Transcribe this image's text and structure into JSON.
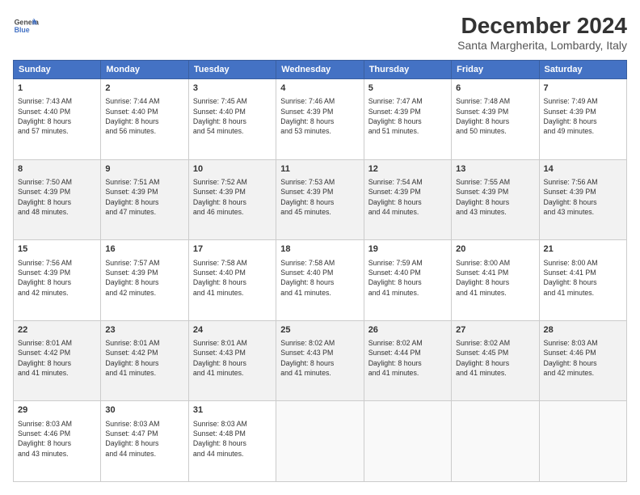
{
  "header": {
    "logo_general": "General",
    "logo_blue": "Blue",
    "title": "December 2024",
    "subtitle": "Santa Margherita, Lombardy, Italy"
  },
  "days_of_week": [
    "Sunday",
    "Monday",
    "Tuesday",
    "Wednesday",
    "Thursday",
    "Friday",
    "Saturday"
  ],
  "weeks": [
    [
      {
        "day": "1",
        "info": "Sunrise: 7:43 AM\nSunset: 4:40 PM\nDaylight: 8 hours\nand 57 minutes."
      },
      {
        "day": "2",
        "info": "Sunrise: 7:44 AM\nSunset: 4:40 PM\nDaylight: 8 hours\nand 56 minutes."
      },
      {
        "day": "3",
        "info": "Sunrise: 7:45 AM\nSunset: 4:40 PM\nDaylight: 8 hours\nand 54 minutes."
      },
      {
        "day": "4",
        "info": "Sunrise: 7:46 AM\nSunset: 4:39 PM\nDaylight: 8 hours\nand 53 minutes."
      },
      {
        "day": "5",
        "info": "Sunrise: 7:47 AM\nSunset: 4:39 PM\nDaylight: 8 hours\nand 51 minutes."
      },
      {
        "day": "6",
        "info": "Sunrise: 7:48 AM\nSunset: 4:39 PM\nDaylight: 8 hours\nand 50 minutes."
      },
      {
        "day": "7",
        "info": "Sunrise: 7:49 AM\nSunset: 4:39 PM\nDaylight: 8 hours\nand 49 minutes."
      }
    ],
    [
      {
        "day": "8",
        "info": "Sunrise: 7:50 AM\nSunset: 4:39 PM\nDaylight: 8 hours\nand 48 minutes."
      },
      {
        "day": "9",
        "info": "Sunrise: 7:51 AM\nSunset: 4:39 PM\nDaylight: 8 hours\nand 47 minutes."
      },
      {
        "day": "10",
        "info": "Sunrise: 7:52 AM\nSunset: 4:39 PM\nDaylight: 8 hours\nand 46 minutes."
      },
      {
        "day": "11",
        "info": "Sunrise: 7:53 AM\nSunset: 4:39 PM\nDaylight: 8 hours\nand 45 minutes."
      },
      {
        "day": "12",
        "info": "Sunrise: 7:54 AM\nSunset: 4:39 PM\nDaylight: 8 hours\nand 44 minutes."
      },
      {
        "day": "13",
        "info": "Sunrise: 7:55 AM\nSunset: 4:39 PM\nDaylight: 8 hours\nand 43 minutes."
      },
      {
        "day": "14",
        "info": "Sunrise: 7:56 AM\nSunset: 4:39 PM\nDaylight: 8 hours\nand 43 minutes."
      }
    ],
    [
      {
        "day": "15",
        "info": "Sunrise: 7:56 AM\nSunset: 4:39 PM\nDaylight: 8 hours\nand 42 minutes."
      },
      {
        "day": "16",
        "info": "Sunrise: 7:57 AM\nSunset: 4:39 PM\nDaylight: 8 hours\nand 42 minutes."
      },
      {
        "day": "17",
        "info": "Sunrise: 7:58 AM\nSunset: 4:40 PM\nDaylight: 8 hours\nand 41 minutes."
      },
      {
        "day": "18",
        "info": "Sunrise: 7:58 AM\nSunset: 4:40 PM\nDaylight: 8 hours\nand 41 minutes."
      },
      {
        "day": "19",
        "info": "Sunrise: 7:59 AM\nSunset: 4:40 PM\nDaylight: 8 hours\nand 41 minutes."
      },
      {
        "day": "20",
        "info": "Sunrise: 8:00 AM\nSunset: 4:41 PM\nDaylight: 8 hours\nand 41 minutes."
      },
      {
        "day": "21",
        "info": "Sunrise: 8:00 AM\nSunset: 4:41 PM\nDaylight: 8 hours\nand 41 minutes."
      }
    ],
    [
      {
        "day": "22",
        "info": "Sunrise: 8:01 AM\nSunset: 4:42 PM\nDaylight: 8 hours\nand 41 minutes."
      },
      {
        "day": "23",
        "info": "Sunrise: 8:01 AM\nSunset: 4:42 PM\nDaylight: 8 hours\nand 41 minutes."
      },
      {
        "day": "24",
        "info": "Sunrise: 8:01 AM\nSunset: 4:43 PM\nDaylight: 8 hours\nand 41 minutes."
      },
      {
        "day": "25",
        "info": "Sunrise: 8:02 AM\nSunset: 4:43 PM\nDaylight: 8 hours\nand 41 minutes."
      },
      {
        "day": "26",
        "info": "Sunrise: 8:02 AM\nSunset: 4:44 PM\nDaylight: 8 hours\nand 41 minutes."
      },
      {
        "day": "27",
        "info": "Sunrise: 8:02 AM\nSunset: 4:45 PM\nDaylight: 8 hours\nand 41 minutes."
      },
      {
        "day": "28",
        "info": "Sunrise: 8:03 AM\nSunset: 4:46 PM\nDaylight: 8 hours\nand 42 minutes."
      }
    ],
    [
      {
        "day": "29",
        "info": "Sunrise: 8:03 AM\nSunset: 4:46 PM\nDaylight: 8 hours\nand 43 minutes."
      },
      {
        "day": "30",
        "info": "Sunrise: 8:03 AM\nSunset: 4:47 PM\nDaylight: 8 hours\nand 44 minutes."
      },
      {
        "day": "31",
        "info": "Sunrise: 8:03 AM\nSunset: 4:48 PM\nDaylight: 8 hours\nand 44 minutes."
      },
      {
        "day": "",
        "info": ""
      },
      {
        "day": "",
        "info": ""
      },
      {
        "day": "",
        "info": ""
      },
      {
        "day": "",
        "info": ""
      }
    ]
  ]
}
